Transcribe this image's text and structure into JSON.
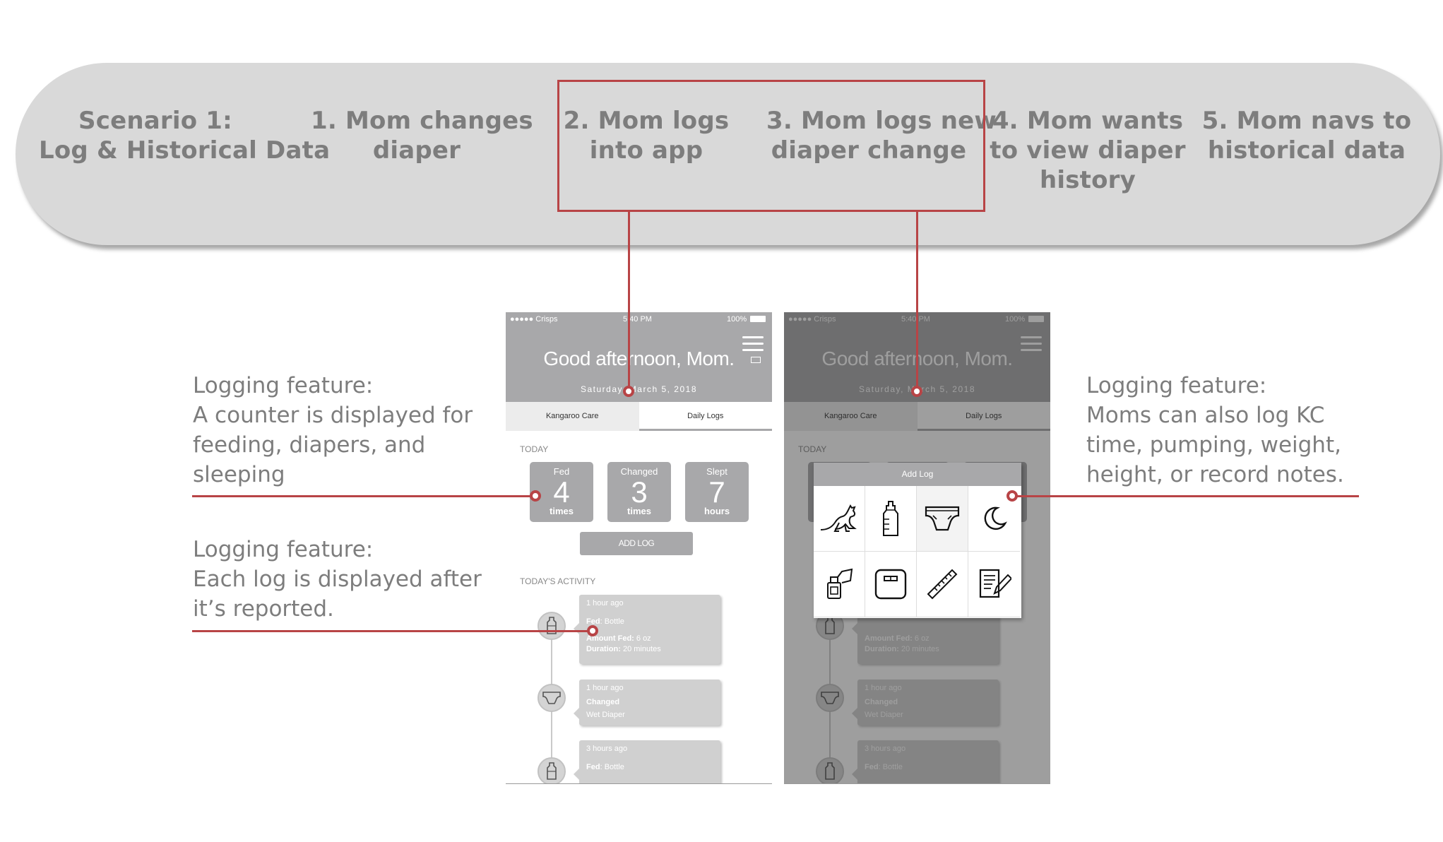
{
  "scenario": {
    "title_line1": "Scenario 1:",
    "title_line2": "Log & Historical Data",
    "steps": [
      {
        "line1": "1. Mom changes",
        "line2": "diaper"
      },
      {
        "line1": "2. Mom logs",
        "line2": "into app"
      },
      {
        "line1": "3. Mom logs new",
        "line2": "diaper change"
      },
      {
        "line1": "4. Mom wants",
        "line2": "to view diaper",
        "line3": "history"
      },
      {
        "line1": "5. Mom navs to",
        "line2": "historical data"
      }
    ]
  },
  "annotations": {
    "counter": [
      "Logging feature:",
      "A counter is displayed for",
      "feeding, diapers, and",
      "sleeping"
    ],
    "log": [
      "Logging feature:",
      "Each log is displayed after",
      "it’s reported."
    ],
    "addlog": [
      "Logging feature:",
      "Moms can also log KC",
      "time, pumping, weight,",
      "height, or record notes."
    ]
  },
  "phone": {
    "carrier": "●●●●● Crisps",
    "time": "5:40 PM",
    "battery": "100%",
    "greeting": "Good afternoon, Mom.",
    "date": "Saturday, March 5, 2018",
    "tabs": [
      "Kangaroo Care",
      "Daily Logs"
    ],
    "today_label": "TODAY",
    "counters": [
      {
        "label": "Fed",
        "value": "4",
        "unit": "times"
      },
      {
        "label": "Changed",
        "value": "3",
        "unit": "times"
      },
      {
        "label": "Slept",
        "value": "7",
        "unit": "hours"
      }
    ],
    "add_log": "ADD LOG",
    "activity_title": "TODAY'S ACTIVITY",
    "activity": [
      {
        "time": "1 hour ago",
        "type": "Fed",
        "detail": "Bottle",
        "amount_label": "Amount Fed:",
        "amount": "6 oz",
        "duration_label": "Duration:",
        "duration": "20 minutes"
      },
      {
        "time": "1 hour ago",
        "type": "Changed",
        "detail": "Wet Diaper"
      },
      {
        "time": "3 hours ago",
        "type": "Fed",
        "detail": "Bottle"
      }
    ]
  },
  "modal": {
    "title": "Add Log",
    "options": [
      "kangaroo-icon",
      "bottle-icon",
      "diaper-icon",
      "moon-icon",
      "pump-icon",
      "scale-icon",
      "ruler-icon",
      "notes-icon"
    ]
  },
  "colors": {
    "accent": "#b84446",
    "banner": "#d9d9d9",
    "text_gray": "#7d7d7d",
    "header_gray": "#a8a8aa"
  }
}
